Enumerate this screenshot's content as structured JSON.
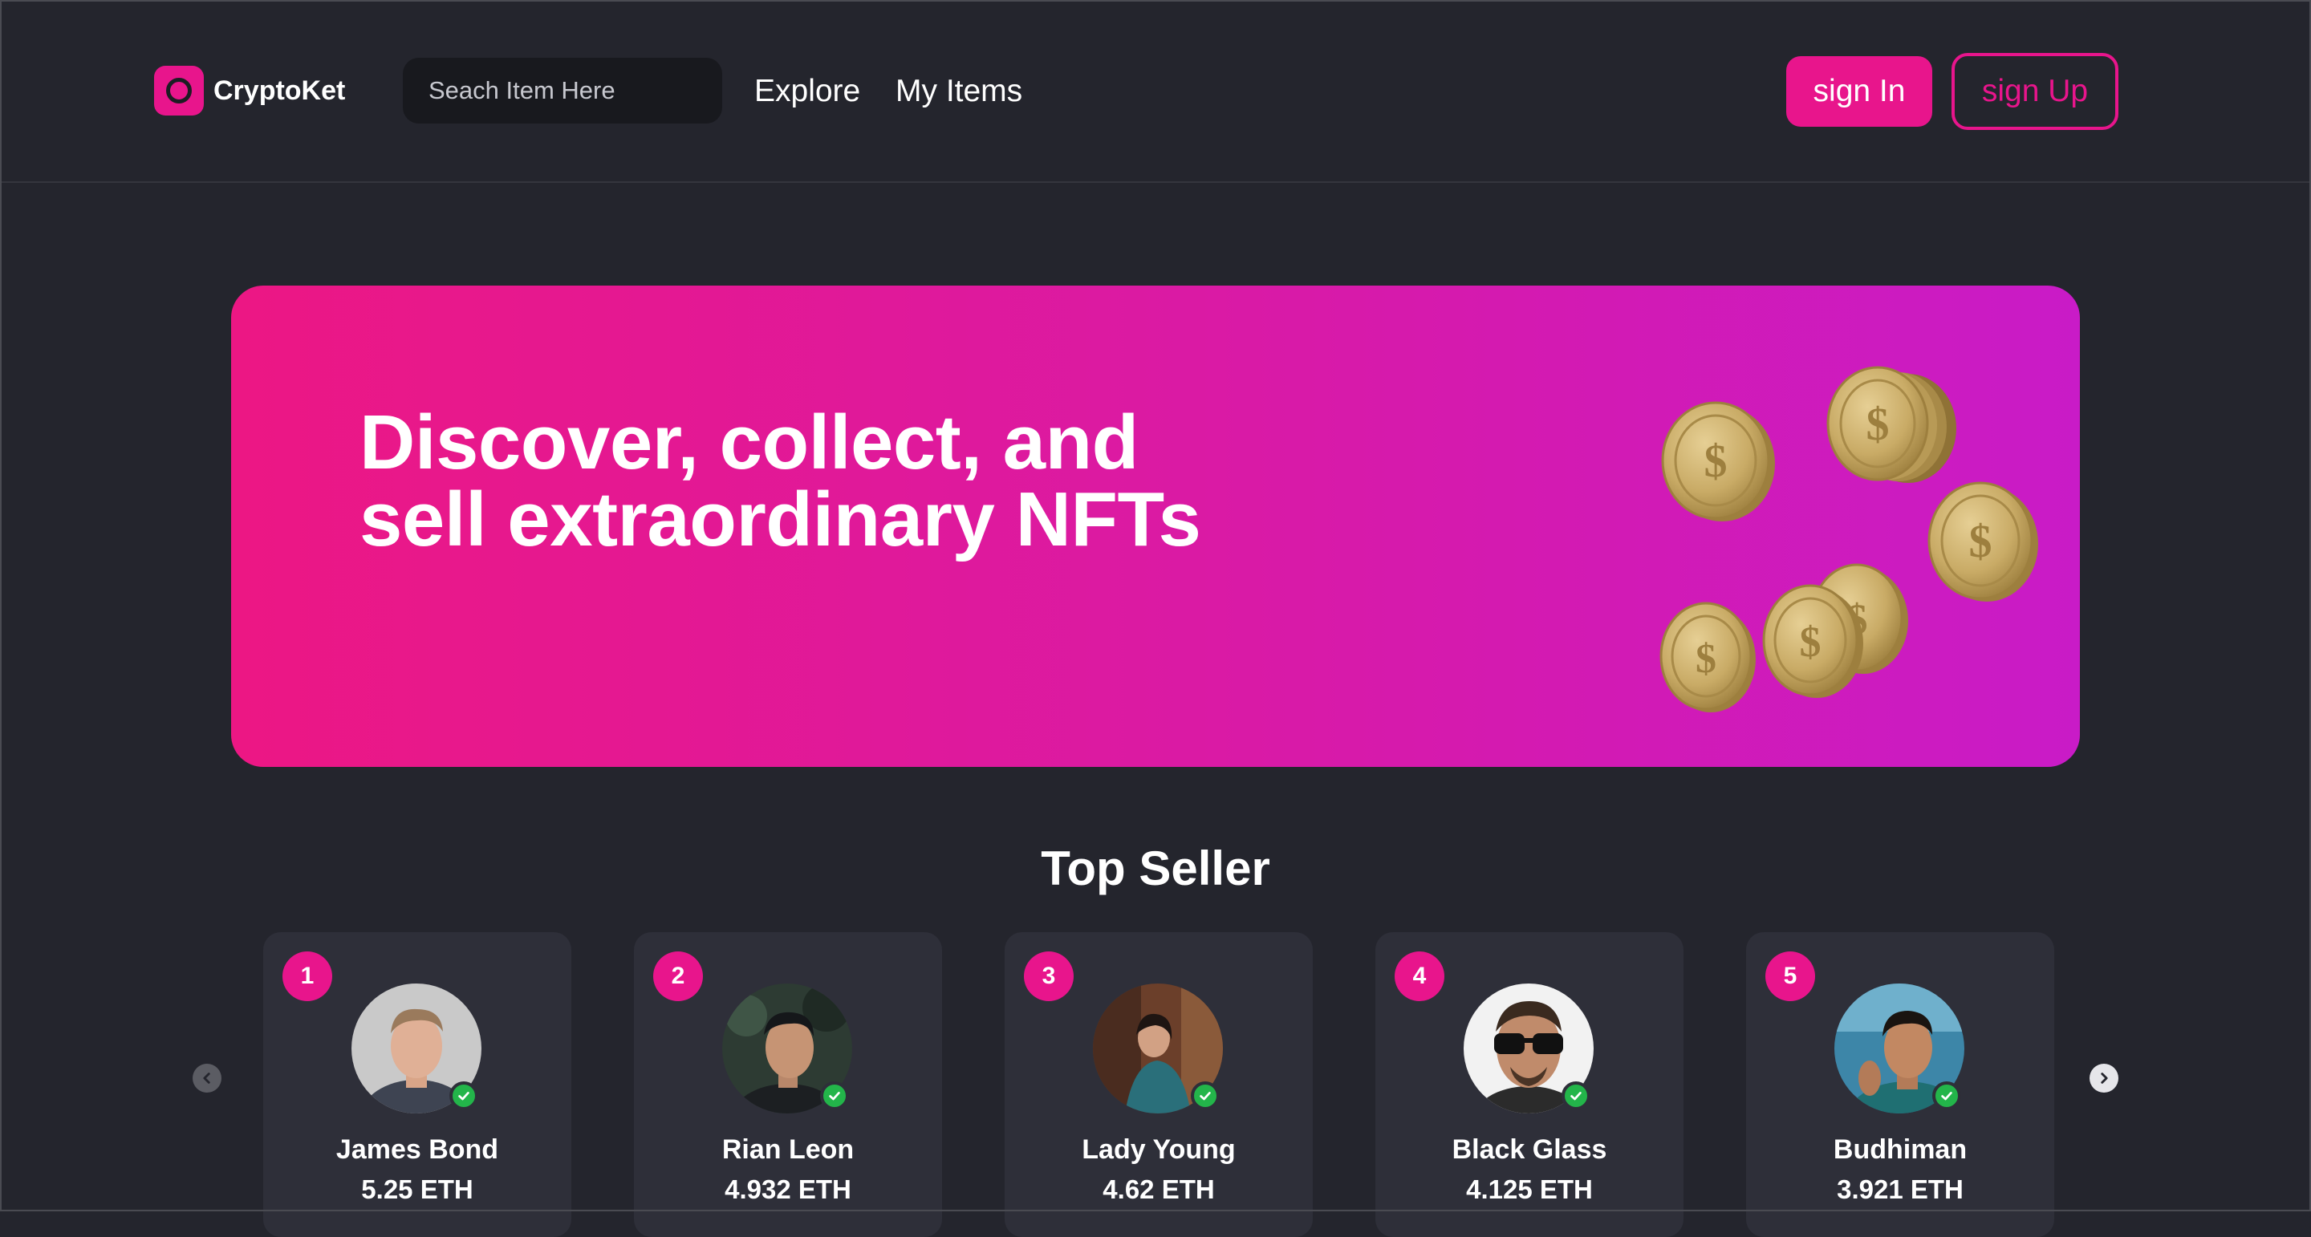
{
  "brand": {
    "name": "CryptoKet",
    "logo_icon": "circle-logo-icon",
    "accent": "#e8158c"
  },
  "search": {
    "placeholder": "Seach Item Here"
  },
  "nav": {
    "explore": "Explore",
    "my_items": "My Items"
  },
  "auth": {
    "sign_in": "sign In",
    "sign_up": "sign Up"
  },
  "hero": {
    "title": "Discover, collect, and sell extraordinary NFTs",
    "image": "gold-coins-icon",
    "gradient": [
      "#ec1784",
      "#c91bc7"
    ]
  },
  "top_seller": {
    "title": "Top Seller",
    "prev_icon": "chevron-left-icon",
    "next_icon": "chevron-right-icon",
    "sellers": [
      {
        "rank": "1",
        "name": "James Bond",
        "eth": "5.25 ETH",
        "verified": true
      },
      {
        "rank": "2",
        "name": "Rian Leon",
        "eth": "4.932 ETH",
        "verified": true
      },
      {
        "rank": "3",
        "name": "Lady Young",
        "eth": "4.62 ETH",
        "verified": true
      },
      {
        "rank": "4",
        "name": "Black Glass",
        "eth": "4.125 ETH",
        "verified": true
      },
      {
        "rank": "5",
        "name": "Budhiman",
        "eth": "3.921 ETH",
        "verified": true
      }
    ]
  }
}
